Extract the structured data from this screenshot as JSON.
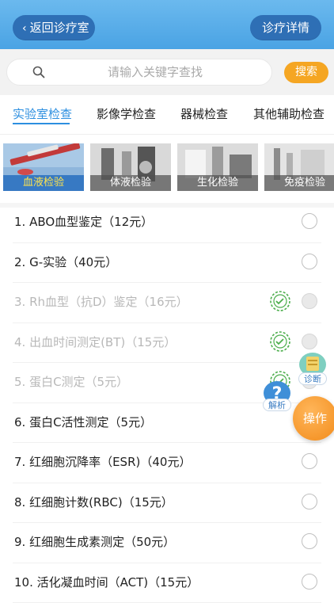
{
  "header": {
    "back_label": "返回诊疗室",
    "detail_label": "诊疗详情"
  },
  "search": {
    "placeholder": "请输入关键字查找",
    "button_label": "搜索"
  },
  "tabs": [
    {
      "label": "实验室检查",
      "active": true
    },
    {
      "label": "影像学检查",
      "active": false
    },
    {
      "label": "器械检查",
      "active": false
    },
    {
      "label": "其他辅助检查",
      "active": false
    }
  ],
  "categories": [
    {
      "label": "血液检验",
      "active": true
    },
    {
      "label": "体液检验",
      "active": false
    },
    {
      "label": "生化检验",
      "active": false
    },
    {
      "label": "免疫检验",
      "active": false
    }
  ],
  "items": [
    {
      "label": "1. ABO血型鉴定（12元）",
      "done": false
    },
    {
      "label": "2. G-实验（40元）",
      "done": false
    },
    {
      "label": "3. Rh血型（抗D）鉴定（16元）",
      "done": true
    },
    {
      "label": "4. 出血时间测定(BT)（15元）",
      "done": true
    },
    {
      "label": "5. 蛋白C测定（5元）",
      "done": true
    },
    {
      "label": "6. 蛋白C活性测定（5元）",
      "done": false
    },
    {
      "label": "7. 红细胞沉降率（ESR)（40元）",
      "done": false
    },
    {
      "label": "8. 红细胞计数(RBC)（15元）",
      "done": false
    },
    {
      "label": "9. 红细胞生成素测定（50元）",
      "done": false
    },
    {
      "label": "10. 活化凝血时间（ACT)（15元）",
      "done": false
    }
  ],
  "floating": {
    "diagnosis_label": "诊断",
    "analysis_label": "解析",
    "operate_label": "操作"
  },
  "colors": {
    "header": "#4aa3e4",
    "header_button": "#2e6fb5",
    "accent": "#2d8fe0",
    "search_button": "#f5a623",
    "done_stamp": "#4cae4c"
  }
}
